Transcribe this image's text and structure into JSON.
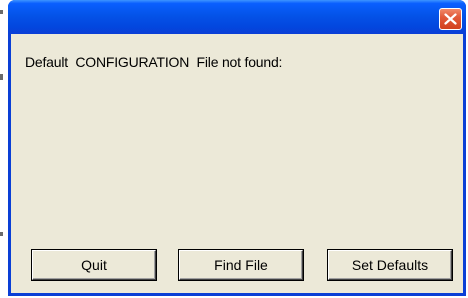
{
  "window": {
    "title": "",
    "close_icon": "close-icon",
    "titlebar_color": "#0453e8",
    "close_color": "#d2411e",
    "client_color": "#ece9d8"
  },
  "dialog": {
    "message": "Default  CONFIGURATION  File not found:"
  },
  "buttons": {
    "quit": "Quit",
    "find_file": "Find File",
    "set_defaults": "Set Defaults"
  }
}
